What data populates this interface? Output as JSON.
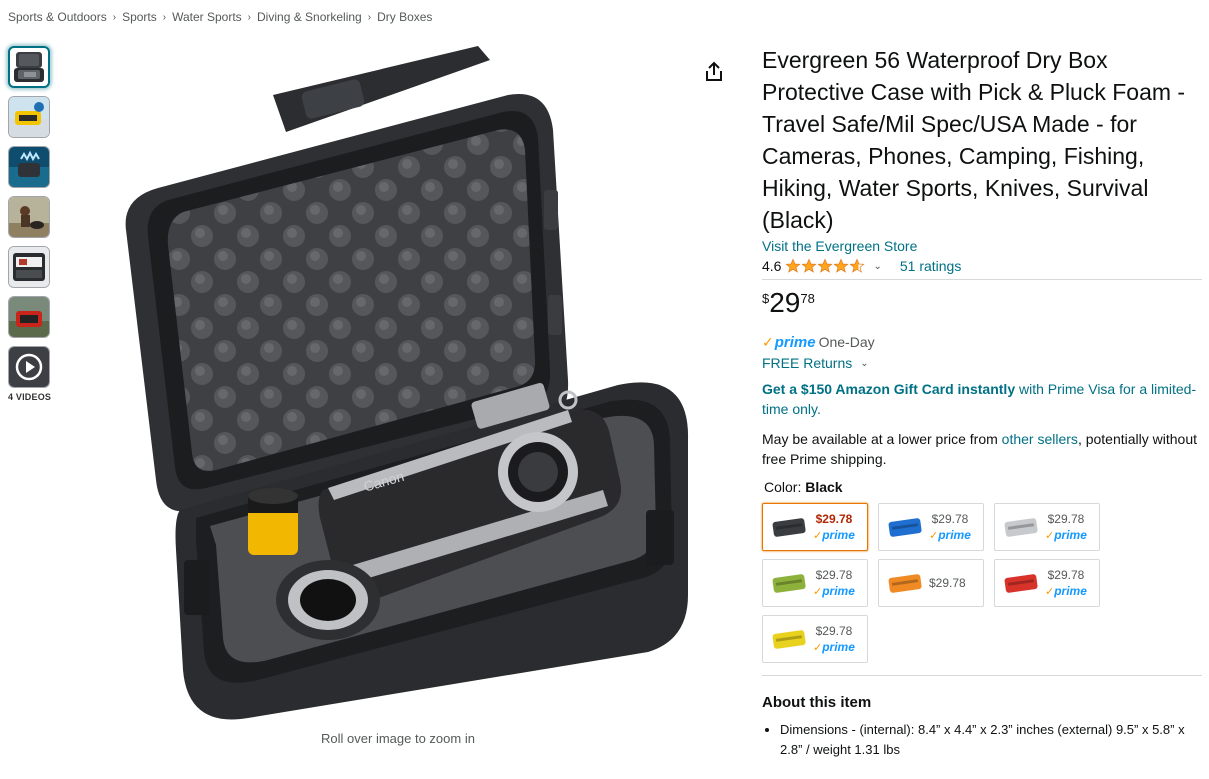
{
  "breadcrumb": [
    "Sports & Outdoors",
    "Sports",
    "Water Sports",
    "Diving & Snorkeling",
    "Dry Boxes"
  ],
  "breadcrumb_separator": "›",
  "gallery": {
    "thumbnails": [
      {
        "name": "case-open-black"
      },
      {
        "name": "case-on-boat"
      },
      {
        "name": "case-in-water"
      },
      {
        "name": "person-with-dog"
      },
      {
        "name": "case-contents"
      },
      {
        "name": "case-red-outdoor"
      },
      {
        "name": "video"
      }
    ],
    "videos_label": "4 VIDEOS",
    "zoom_hint": "Roll over image to zoom in",
    "main_brand_text": "Canon"
  },
  "product": {
    "title": "Evergreen 56 Waterproof Dry Box Protective Case with Pick & Pluck Foam - Travel Safe/Mil Spec/USA Made - for Cameras, Phones, Camping, Fishing, Hiking, Water Sports, Knives, Survival (Black)",
    "store_link": "Visit the Evergreen Store",
    "rating": "4.6",
    "rating_value": 4.6,
    "ratings_count": "51 ratings",
    "price": {
      "symbol": "$",
      "whole": "29",
      "fraction": "78"
    },
    "prime_word": "prime",
    "prime_check": "✓",
    "prime_suffix": "One-Day",
    "free_returns": "FREE Returns",
    "gift_offer": {
      "bold": "Get a $150 Amazon Gift Card instantly",
      "rest": " with Prime Visa for a limited-time only."
    },
    "other_sellers": {
      "before": "May be available at a lower price from ",
      "link": "other sellers",
      "after": ", potentially without free Prime shipping."
    },
    "color_label": "Color: ",
    "color_value": "Black",
    "swatches": [
      {
        "name": "black",
        "price": "$29.78",
        "prime": true,
        "color": "#3a3d40",
        "selected": true
      },
      {
        "name": "blue",
        "price": "$29.78",
        "prime": true,
        "color": "#1e6fd0",
        "selected": false
      },
      {
        "name": "clear",
        "price": "$29.78",
        "prime": true,
        "color": "#c7cacd",
        "selected": false
      },
      {
        "name": "olive",
        "price": "$29.78",
        "prime": true,
        "color": "#8db13a",
        "selected": false
      },
      {
        "name": "orange",
        "price": "$29.78",
        "prime": false,
        "color": "#f08a24",
        "selected": false
      },
      {
        "name": "red",
        "price": "$29.78",
        "prime": true,
        "color": "#d8332a",
        "selected": false
      },
      {
        "name": "yellow",
        "price": "$29.78",
        "prime": true,
        "color": "#e8d21e",
        "selected": false
      }
    ],
    "about_title": "About this item",
    "bullets": [
      "Dimensions - (internal): 8.4” x 4.4” x 2.3” inches (external) 9.5” x 5.8” x 2.8” / weight 1.31 lbs"
    ]
  },
  "colors": {
    "link": "#007185",
    "star": "#ffa41c",
    "price_red": "#b12704",
    "prime_blue": "#1399ff",
    "selected_border": "#e77600"
  }
}
